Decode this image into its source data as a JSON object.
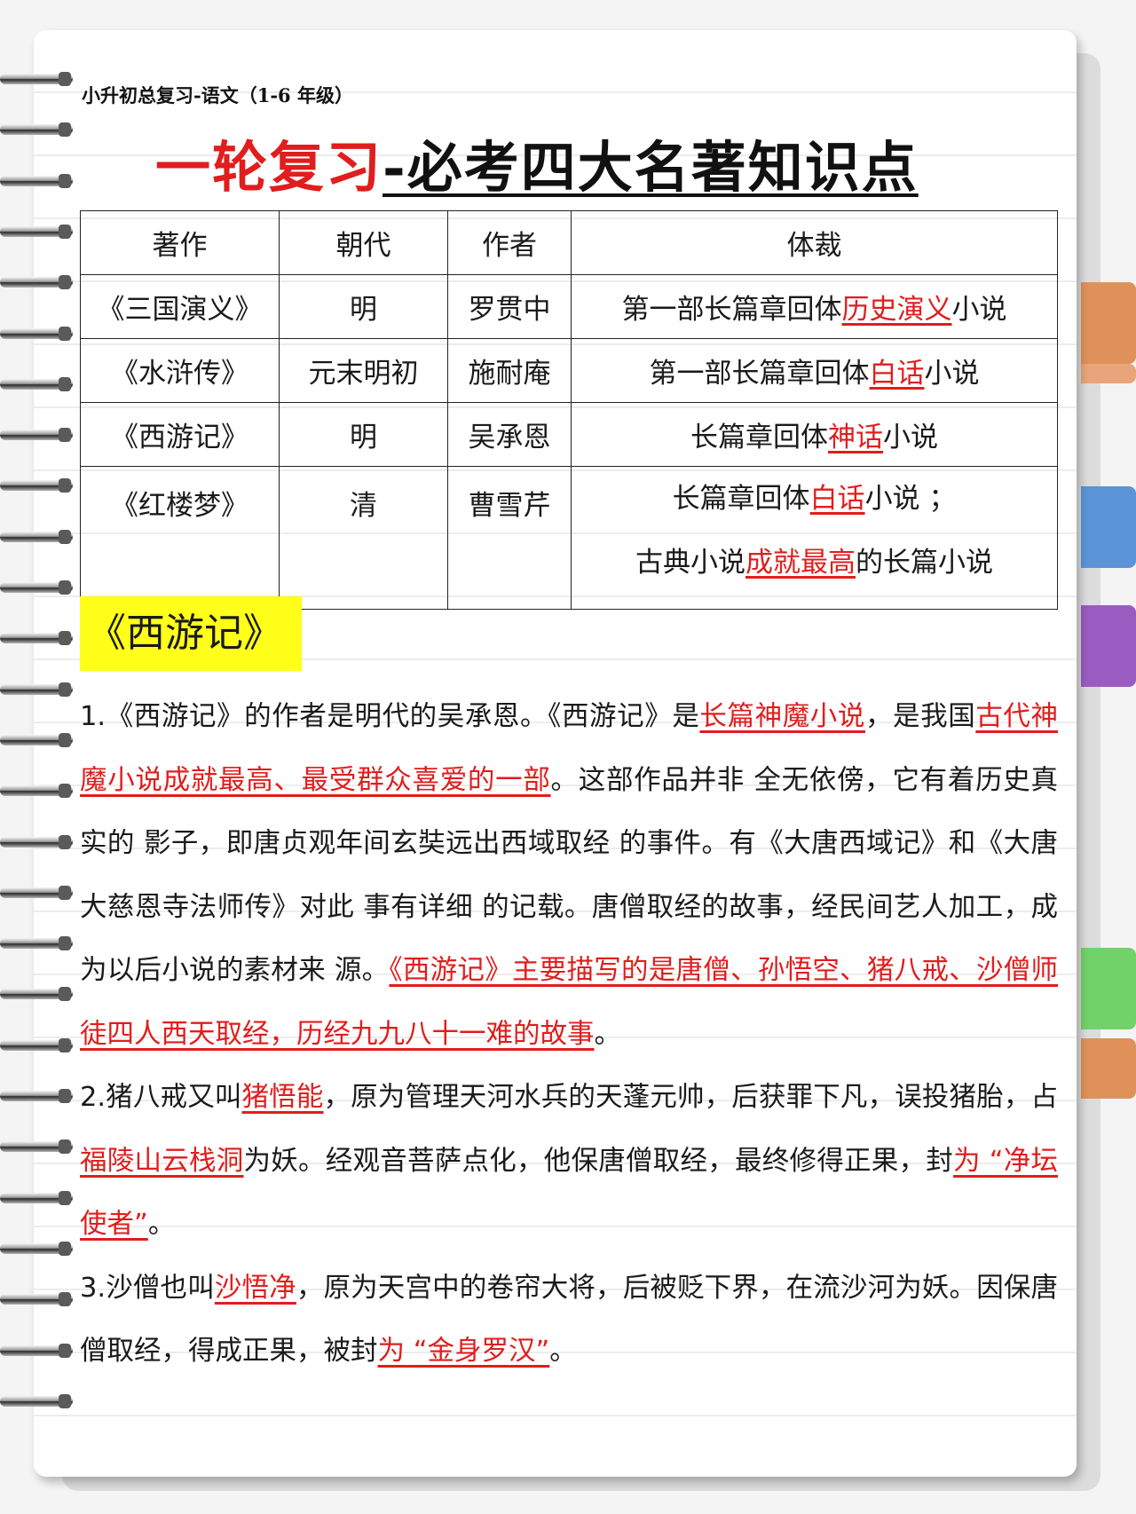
{
  "header": {
    "subtitle": "小升初总复习-语文（1-6 年级）",
    "title_red": "一轮复习",
    "title_black": "-必考四大名著知识点"
  },
  "table": {
    "headers": [
      "著作",
      "朝代",
      "作者",
      "体裁"
    ],
    "rows": [
      {
        "work": "《三国演义》",
        "dynasty": "明",
        "author": "罗贯中",
        "genre": [
          {
            "t": "第一部长篇章回体",
            "h": false
          },
          {
            "t": "历史演义",
            "h": true
          },
          {
            "t": "小说",
            "h": false
          }
        ]
      },
      {
        "work": "《水浒传》",
        "dynasty": "元末明初",
        "author": "施耐庵",
        "genre": [
          {
            "t": "第一部长篇章回体",
            "h": false
          },
          {
            "t": "白话",
            "h": true
          },
          {
            "t": "小说",
            "h": false
          }
        ]
      },
      {
        "work": "《西游记》",
        "dynasty": "明",
        "author": "吴承恩",
        "genre": [
          {
            "t": "长篇章回体",
            "h": false
          },
          {
            "t": "神话",
            "h": true
          },
          {
            "t": "小说",
            "h": false
          }
        ]
      },
      {
        "work": "《红楼梦》",
        "dynasty": "清",
        "author": "曹雪芹",
        "genre": [
          {
            "t": "长篇章回体",
            "h": false
          },
          {
            "t": "白话",
            "h": true
          },
          {
            "t": "小说 ；",
            "h": false
          }
        ],
        "genre2": [
          {
            "t": "古典小说",
            "h": false
          },
          {
            "t": "成就最高",
            "h": true
          },
          {
            "t": "的长篇小说",
            "h": false
          }
        ]
      }
    ]
  },
  "section_title": "《西游记》",
  "paragraphs": [
    [
      {
        "t": "1.《西游记》的作者是明代的吴承恩。《西游记》是",
        "h": false
      },
      {
        "t": "长篇神魔小说",
        "h": true
      },
      {
        "t": "，是我国",
        "h": false
      },
      {
        "t": "古代神魔小说成就最高、最受群众喜爱的一部",
        "h": true
      },
      {
        "t": "。这部作品并非 全无依傍，它有着历史真实的 影子，即唐贞观年间玄奘远出西域取经 的事件。有《大唐西域记》和《大唐大慈恩寺法师传》对此 事有详细 的记载。唐僧取经的故事，经民间艺人加工，成为以后小说的素材来 源。",
        "h": false
      },
      {
        "t": "《西游记》主要描写的是唐僧、孙悟空、猪八戒、沙僧师徒四人西天取经，历经九九八十一难的故事",
        "h": true
      },
      {
        "t": "。",
        "h": false
      }
    ],
    [
      {
        "t": "2.猪八戒又叫",
        "h": false
      },
      {
        "t": "猪悟能",
        "h": true
      },
      {
        "t": "，原为管理天河水兵的天蓬元帅，后获罪下凡，误投猪胎，占",
        "h": false
      },
      {
        "t": "福陵山云栈洞",
        "h": true
      },
      {
        "t": "为妖。经观音菩萨点化，他保唐僧取经，最终修得正果，封",
        "h": false
      },
      {
        "t": "为 “净坛使者”",
        "h": true
      },
      {
        "t": "。",
        "h": false
      }
    ],
    [
      {
        "t": "3.沙僧也叫",
        "h": false
      },
      {
        "t": "沙悟净",
        "h": true
      },
      {
        "t": "，原为天宫中的卷帘大将，后被贬下界，在流沙河为妖。因保唐僧取经，得成正果，被封",
        "h": false
      },
      {
        "t": "为 “金身罗汉”",
        "h": true
      },
      {
        "t": "。",
        "h": false
      }
    ]
  ],
  "colors": {
    "highlight_red": "#e11d1d",
    "badge_yellow": "#ffff1a",
    "tabs": [
      "#e0915a",
      "#e0915a",
      "#5b95d8",
      "#9a5cc0",
      "#72d26a",
      "#e0915a"
    ]
  }
}
